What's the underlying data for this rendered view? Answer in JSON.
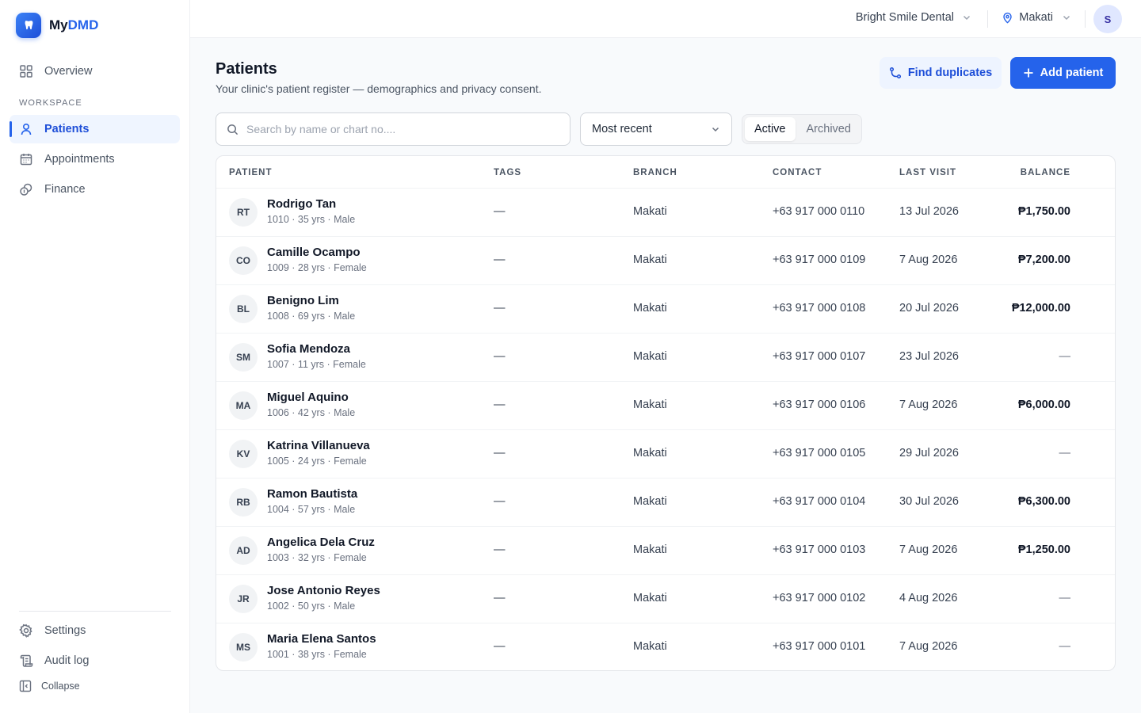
{
  "brand": {
    "name_part1": "My",
    "name_part2": "DMD"
  },
  "sidebar": {
    "overview": "Overview",
    "section_label": "WORKSPACE",
    "items": [
      {
        "label": "Patients",
        "active": true
      },
      {
        "label": "Appointments",
        "active": false
      },
      {
        "label": "Finance",
        "active": false
      }
    ],
    "settings": "Settings",
    "audit_log": "Audit log",
    "collapse": "Collapse"
  },
  "topbar": {
    "clinic": "Bright Smile Dental",
    "branch": "Makati",
    "user_initial": "S"
  },
  "page": {
    "title": "Patients",
    "subtitle": "Your clinic's patient register — demographics and privacy consent.",
    "find_duplicates": "Find duplicates",
    "add_patient": "Add patient"
  },
  "filters": {
    "search_placeholder": "Search by name or chart no....",
    "sort_value": "Most recent",
    "status_tabs": [
      "Active",
      "Archived"
    ],
    "active_tab": "Active"
  },
  "table": {
    "columns": [
      "PATIENT",
      "TAGS",
      "BRANCH",
      "CONTACT",
      "LAST VISIT",
      "BALANCE"
    ],
    "rows": [
      {
        "initials": "RT",
        "name": "Rodrigo Tan",
        "meta": "1010 · 35 yrs · Male",
        "tags": "—",
        "branch": "Makati",
        "contact": "+63 917 000 0110",
        "last_visit": "13 Jul 2026",
        "balance": "₱1,750.00"
      },
      {
        "initials": "CO",
        "name": "Camille Ocampo",
        "meta": "1009 · 28 yrs · Female",
        "tags": "—",
        "branch": "Makati",
        "contact": "+63 917 000 0109",
        "last_visit": "7 Aug 2026",
        "balance": "₱7,200.00"
      },
      {
        "initials": "BL",
        "name": "Benigno Lim",
        "meta": "1008 · 69 yrs · Male",
        "tags": "—",
        "branch": "Makati",
        "contact": "+63 917 000 0108",
        "last_visit": "20 Jul 2026",
        "balance": "₱12,000.00"
      },
      {
        "initials": "SM",
        "name": "Sofia Mendoza",
        "meta": "1007 · 11 yrs · Female",
        "tags": "—",
        "branch": "Makati",
        "contact": "+63 917 000 0107",
        "last_visit": "23 Jul 2026",
        "balance": "—"
      },
      {
        "initials": "MA",
        "name": "Miguel Aquino",
        "meta": "1006 · 42 yrs · Male",
        "tags": "—",
        "branch": "Makati",
        "contact": "+63 917 000 0106",
        "last_visit": "7 Aug 2026",
        "balance": "₱6,000.00"
      },
      {
        "initials": "KV",
        "name": "Katrina Villanueva",
        "meta": "1005 · 24 yrs · Female",
        "tags": "—",
        "branch": "Makati",
        "contact": "+63 917 000 0105",
        "last_visit": "29 Jul 2026",
        "balance": "—"
      },
      {
        "initials": "RB",
        "name": "Ramon Bautista",
        "meta": "1004 · 57 yrs · Male",
        "tags": "—",
        "branch": "Makati",
        "contact": "+63 917 000 0104",
        "last_visit": "30 Jul 2026",
        "balance": "₱6,300.00"
      },
      {
        "initials": "AD",
        "name": "Angelica Dela Cruz",
        "meta": "1003 · 32 yrs · Female",
        "tags": "—",
        "branch": "Makati",
        "contact": "+63 917 000 0103",
        "last_visit": "7 Aug 2026",
        "balance": "₱1,250.00"
      },
      {
        "initials": "JR",
        "name": "Jose Antonio Reyes",
        "meta": "1002 · 50 yrs · Male",
        "tags": "—",
        "branch": "Makati",
        "contact": "+63 917 000 0102",
        "last_visit": "4 Aug 2026",
        "balance": "—"
      },
      {
        "initials": "MS",
        "name": "Maria Elena Santos",
        "meta": "1001 · 38 yrs · Female",
        "tags": "—",
        "branch": "Makati",
        "contact": "+63 917 000 0101",
        "last_visit": "7 Aug 2026",
        "balance": "—"
      }
    ]
  },
  "colors": {
    "accent": "#2563eb",
    "accent_soft": "#eef4ff"
  }
}
